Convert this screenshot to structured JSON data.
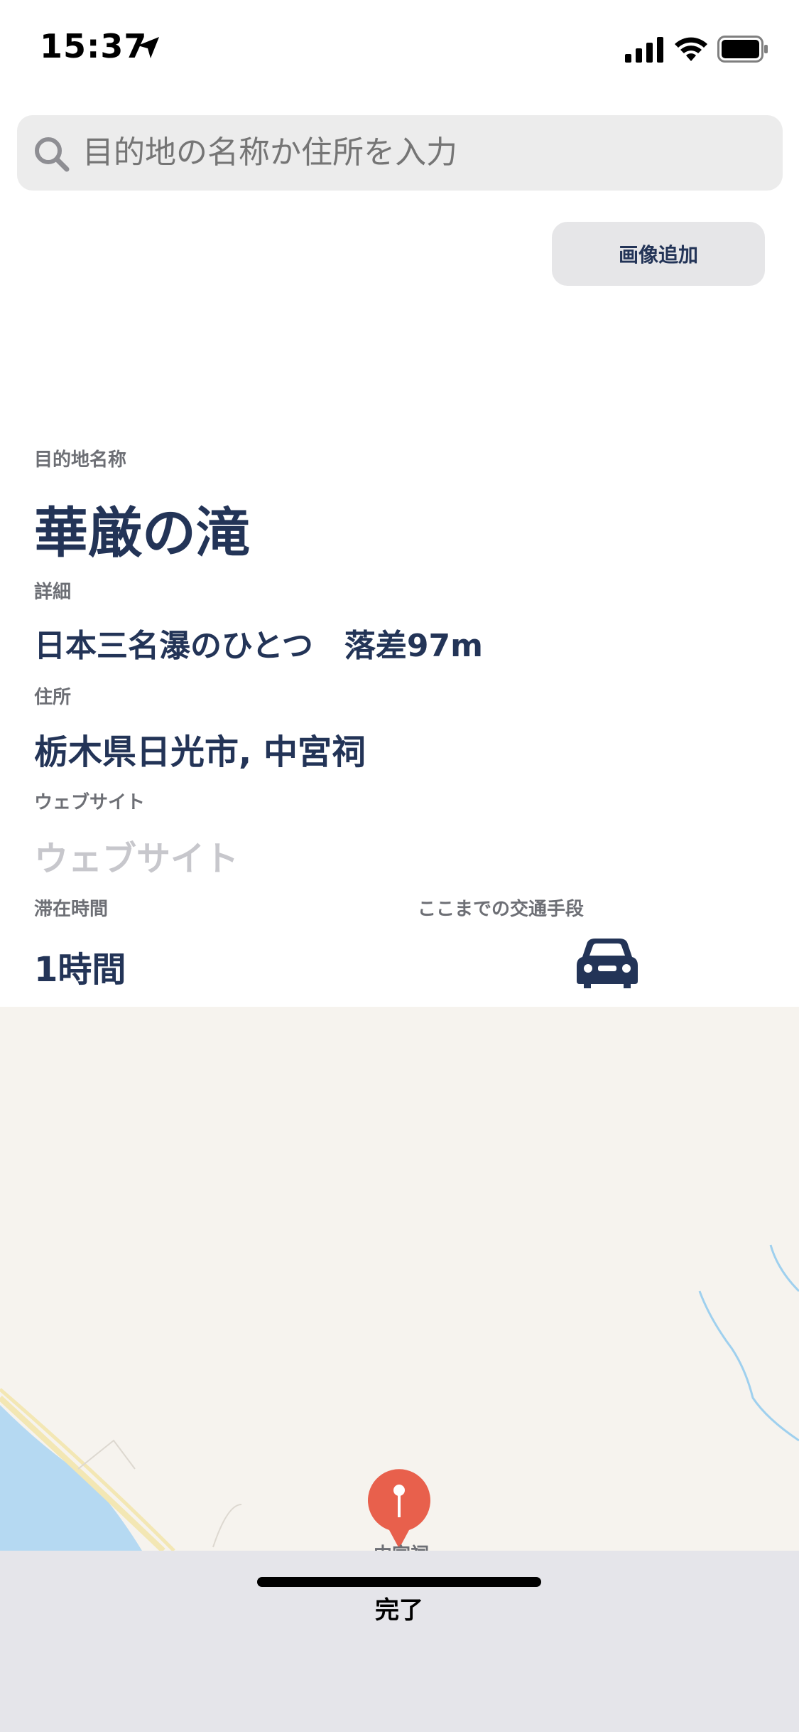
{
  "status_bar": {
    "time": "15:37"
  },
  "search": {
    "placeholder": "目的地の名称か住所を入力"
  },
  "add_image": {
    "label": "画像追加"
  },
  "form": {
    "name_label": "目的地名称",
    "name_value": "華厳の滝",
    "detail_label": "詳細",
    "detail_value": "日本三名瀑のひとつ　落差97m",
    "address_label": "住所",
    "address_value": "栃木県日光市, 中宮祠",
    "website_label": "ウェブサイト",
    "website_placeholder": "ウェブサイト",
    "stay_label": "滞在時間",
    "stay_value": "1時間",
    "transport_label": "ここまでの交通手段",
    "transport_icon": "car-icon"
  },
  "map": {
    "pin_label": "中宮祠",
    "water_color": "#b5d9f2",
    "land_color": "#f6f3ee",
    "pin_color": "#e8604c"
  },
  "footer": {
    "done_label": "完了"
  }
}
